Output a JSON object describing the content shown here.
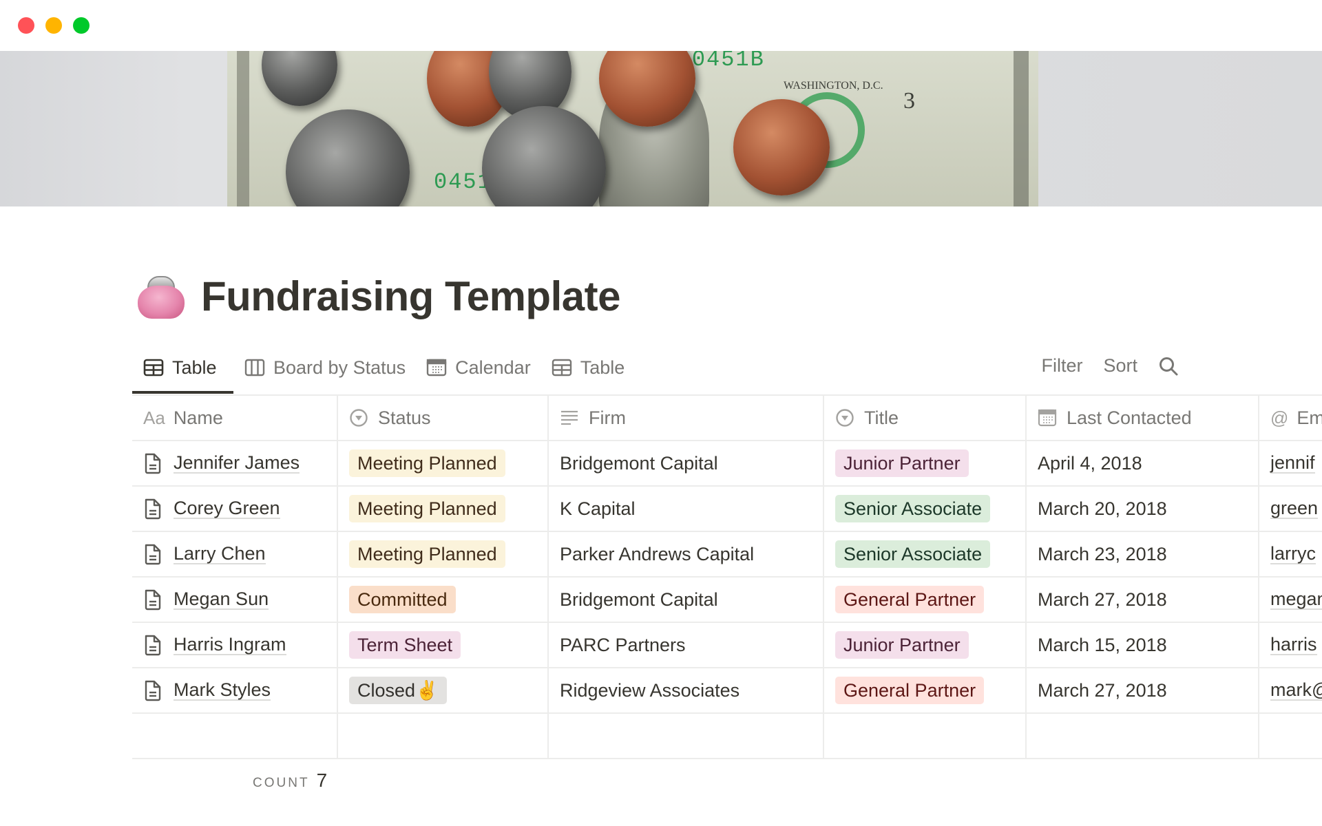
{
  "window": {
    "controls": [
      "close",
      "minimize",
      "maximize"
    ]
  },
  "cover": {
    "description": "Dollar bill with coins",
    "serial_top": "32510451B",
    "serial_left": "0451",
    "city": "WASHINGTON, D.C.",
    "numeral": "3"
  },
  "page": {
    "icon": "purse-icon",
    "title": "Fundraising Template"
  },
  "tabs": [
    {
      "label": "Table",
      "icon": "table-icon",
      "active": true
    },
    {
      "label": "Board by Status",
      "icon": "board-icon",
      "active": false
    },
    {
      "label": "Calendar",
      "icon": "calendar-icon",
      "active": false
    },
    {
      "label": "Table",
      "icon": "table-icon",
      "active": false
    }
  ],
  "toolbar": {
    "filter": "Filter",
    "sort": "Sort",
    "search_icon": "search-icon"
  },
  "columns": [
    {
      "key": "name",
      "label": "Name",
      "icon": "Aa"
    },
    {
      "key": "status",
      "label": "Status",
      "icon": "select-icon"
    },
    {
      "key": "firm",
      "label": "Firm",
      "icon": "text-icon"
    },
    {
      "key": "title",
      "label": "Title",
      "icon": "select-icon"
    },
    {
      "key": "last",
      "label": "Last Contacted",
      "icon": "calendar-icon"
    },
    {
      "key": "email",
      "label": "Em",
      "icon": "at-icon"
    }
  ],
  "tag_colors": {
    "Meeting Planned": {
      "bg": "#fbf3db",
      "fg": "#402c1b"
    },
    "Committed": {
      "bg": "#fadec9",
      "fg": "#49290e"
    },
    "Term Sheet": {
      "bg": "#f4dfeb",
      "fg": "#4c2337"
    },
    "Closed✌️": {
      "bg": "#e3e2e0",
      "fg": "#32302c"
    },
    "Junior Partner": {
      "bg": "#f4dfeb",
      "fg": "#4c2337"
    },
    "Senior Associate": {
      "bg": "#dbeddb",
      "fg": "#1c3829"
    },
    "General Partner": {
      "bg": "#ffe2dd",
      "fg": "#5d1715"
    }
  },
  "rows": [
    {
      "name": "Jennifer James",
      "status": "Meeting Planned",
      "firm": "Bridgemont Capital",
      "title": "Junior Partner",
      "last": "April 4, 2018",
      "email": "jennif"
    },
    {
      "name": "Corey Green",
      "status": "Meeting Planned",
      "firm": "K Capital",
      "title": "Senior Associate",
      "last": "March 20, 2018",
      "email": "green"
    },
    {
      "name": "Larry Chen",
      "status": "Meeting Planned",
      "firm": "Parker Andrews Capital",
      "title": "Senior Associate",
      "last": "March 23, 2018",
      "email": "larryc"
    },
    {
      "name": "Megan Sun",
      "status": "Committed",
      "firm": "Bridgemont Capital",
      "title": "General Partner",
      "last": "March 27, 2018",
      "email": "megan"
    },
    {
      "name": "Harris Ingram",
      "status": "Term Sheet",
      "firm": "PARC Partners",
      "title": "Junior Partner",
      "last": "March 15, 2018",
      "email": "harris"
    },
    {
      "name": "Mark Styles",
      "status": "Closed✌️",
      "firm": "Ridgeview Associates",
      "title": "General Partner",
      "last": "March 27, 2018",
      "email": "mark@"
    }
  ],
  "footer": {
    "count_label": "COUNT",
    "count_value": "7"
  }
}
